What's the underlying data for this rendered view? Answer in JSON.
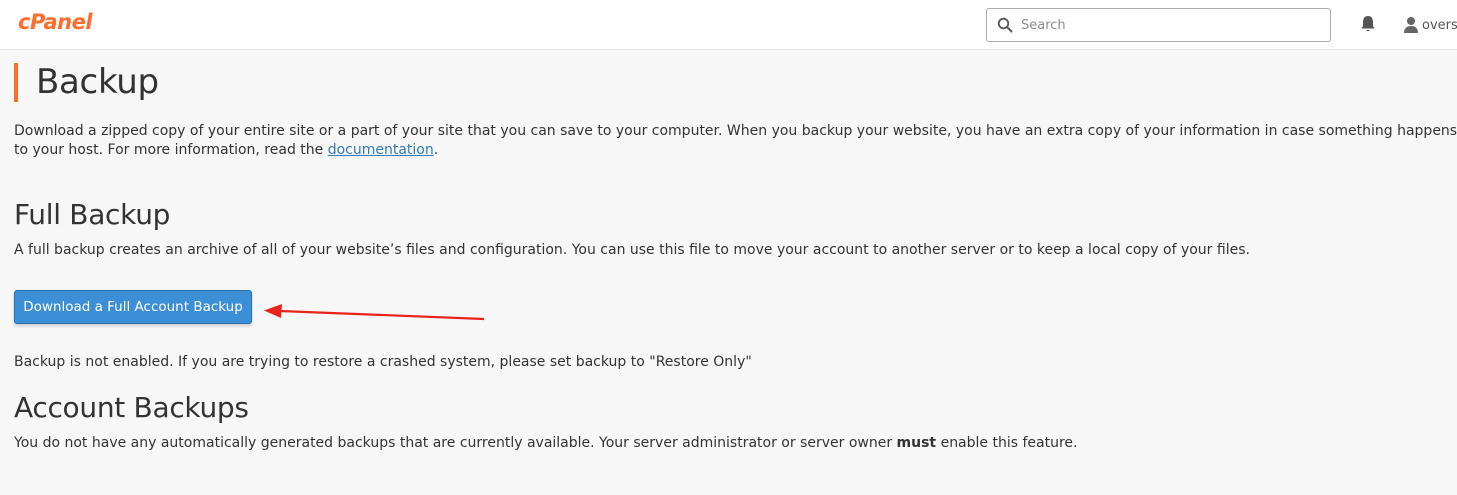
{
  "header": {
    "logo_text": "cPanel",
    "search_placeholder": "Search",
    "user_name": "overst",
    "brand_color": "#ff6c2c"
  },
  "page": {
    "title": "Backup",
    "intro_text": "Download a zipped copy of your entire site or a part of your site that you can save to your computer. When you backup your website, you have an extra copy of your information in case something happens to your host. For more information, read the ",
    "intro_link": "documentation",
    "intro_end": "."
  },
  "full_backup": {
    "heading": "Full Backup",
    "description": "A full backup creates an archive of all of your website’s files and configuration. You can use this file to move your account to another server or to keep a local copy of your files.",
    "button_label": "Download a Full Account Backup",
    "button_color": "#3c8fd6",
    "status_text": "Backup is not enabled. If you are trying to restore a crashed system, please set backup to \"Restore Only\""
  },
  "account_backups": {
    "heading": "Account Backups",
    "text_before": "You do not have any automatically generated backups that are currently available. Your server administrator or server owner ",
    "text_bold": "must",
    "text_after": " enable this feature."
  },
  "annotation": {
    "arrow_color": "#e8231c",
    "icon": "red-arrow-icon"
  },
  "icons": [
    "search-icon",
    "bell-icon",
    "user-icon"
  ]
}
